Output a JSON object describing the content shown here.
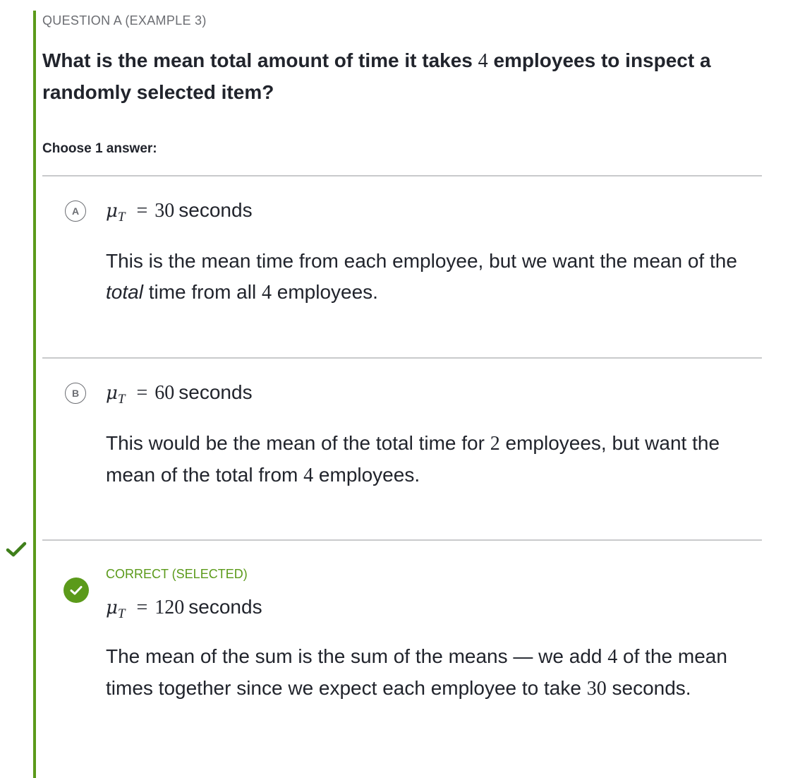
{
  "question": {
    "label": "QUESTION A (EXAMPLE 3)",
    "text_before": "What is the mean total amount of time it takes",
    "count": "4",
    "text_after": "employees to inspect a randomly selected item?",
    "choose_label": "Choose 1 answer:"
  },
  "colors": {
    "accent_green": "#5b9a1a",
    "divider": "#c9cacc",
    "text": "#21242c",
    "muted": "#6b6d72"
  },
  "choices": [
    {
      "letter": "A",
      "symbol": "μ",
      "subscript": "T",
      "equals": "=",
      "value": "30",
      "unit": "seconds",
      "rationale": {
        "p1": "This is the mean time from each employee, but we want the mean of the",
        "emphasis": "total",
        "p2": "time from all",
        "n": "4",
        "p3": "employees."
      }
    },
    {
      "letter": "B",
      "symbol": "μ",
      "subscript": "T",
      "equals": "=",
      "value": "60",
      "unit": "seconds",
      "rationale": {
        "p1": "This would be the mean of the total time for",
        "n1": "2",
        "p2": "employees, but want the mean of the total from",
        "n2": "4",
        "p3": "employees."
      }
    },
    {
      "status": "CORRECT (SELECTED)",
      "status_icon": "checkmark-icon",
      "symbol": "μ",
      "subscript": "T",
      "equals": "=",
      "value": "120",
      "unit": "seconds",
      "rationale": {
        "p1": "The mean of the sum is the sum of the means — we add",
        "n1": "4",
        "p2": "of the mean times together since we expect each employee to take",
        "n2": "30",
        "p3": "seconds."
      }
    }
  ]
}
